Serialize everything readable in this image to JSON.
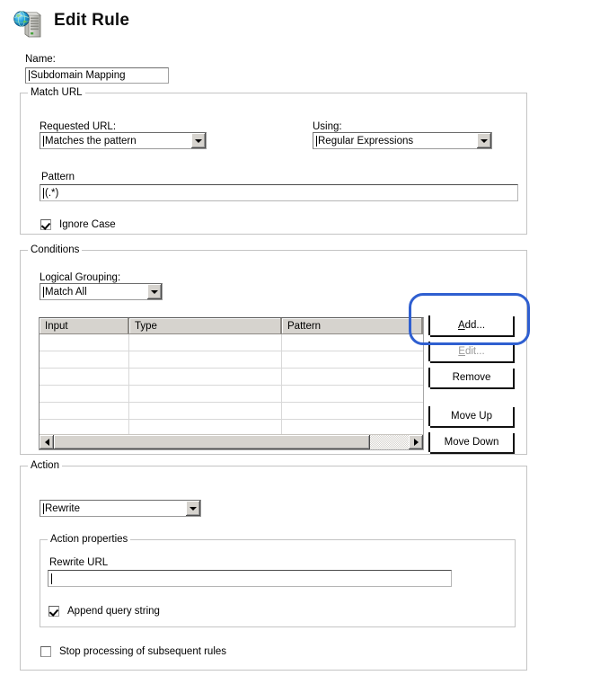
{
  "window": {
    "title": "Edit Rule",
    "icon": "web-server-icon"
  },
  "name_field": {
    "label": "Name:",
    "value": "Subdomain Mapping"
  },
  "match_url": {
    "title": "Match URL",
    "requested_url": {
      "label": "Requested URL:",
      "value": "Matches the pattern"
    },
    "using": {
      "label": "Using:",
      "value": "Regular Expressions"
    },
    "pattern": {
      "label": "Pattern",
      "value": "(.*)"
    },
    "ignore_case": {
      "label": "Ignore Case",
      "checked": true
    }
  },
  "conditions": {
    "title": "Conditions",
    "logical_grouping": {
      "label": "Logical Grouping:",
      "value": "Match All"
    },
    "table": {
      "columns": [
        "Input",
        "Type",
        "Pattern"
      ],
      "rows": [],
      "empty_row_count": 7
    },
    "buttons": [
      {
        "label": "Add...",
        "accel": "A",
        "enabled": true,
        "highlighted": true
      },
      {
        "label": "Edit...",
        "accel": "E",
        "enabled": false,
        "highlighted": false
      },
      {
        "label": "Remove",
        "accel": "",
        "enabled": true,
        "highlighted": false
      },
      {
        "label": "Move Up",
        "accel": "",
        "enabled": true,
        "highlighted": false
      },
      {
        "label": "Move Down",
        "accel": "",
        "enabled": true,
        "highlighted": false
      }
    ]
  },
  "action": {
    "title": "Action",
    "action_type": {
      "value": "Rewrite"
    },
    "properties": {
      "title": "Action properties",
      "rewrite_url": {
        "label": "Rewrite URL",
        "value": ""
      },
      "append_query_string": {
        "label": "Append query string",
        "checked": true
      }
    },
    "stop_processing": {
      "label": "Stop processing of subsequent rules",
      "checked": false
    }
  },
  "annotation": {
    "color": "#2f5fd0",
    "target": "Add..."
  }
}
